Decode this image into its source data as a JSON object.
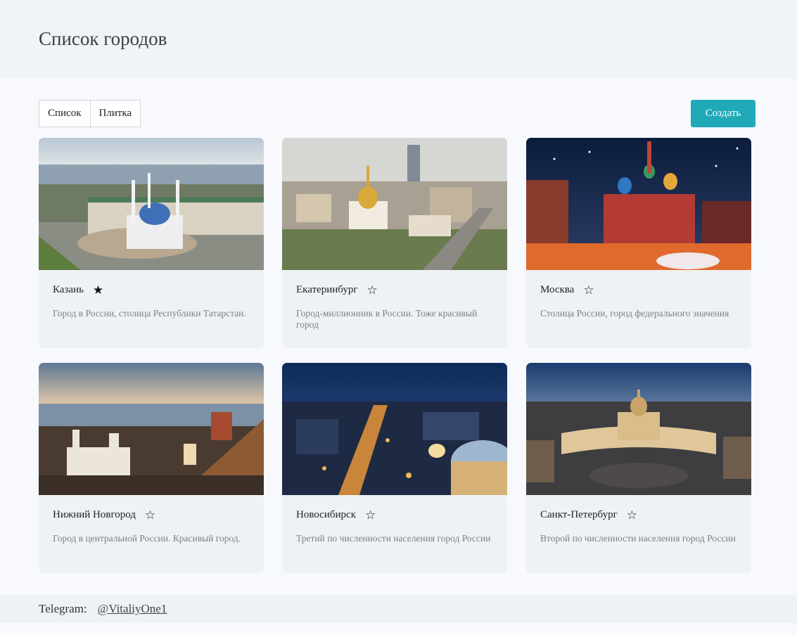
{
  "page": {
    "title": "Список городов"
  },
  "toolbar": {
    "list_label": "Список",
    "tile_label": "Плитка",
    "create_label": "Создать"
  },
  "cities": [
    {
      "name": "Казань",
      "favorite": true,
      "description": "Город в России, столица Республики Татарстан."
    },
    {
      "name": "Екатеринбург",
      "favorite": false,
      "description": "Город-миллионник в России. Тоже красивый город"
    },
    {
      "name": "Москва",
      "favorite": false,
      "description": "Столица России, город федерального значения"
    },
    {
      "name": "Нижний Новгород",
      "favorite": false,
      "description": "Город в центральной России. Красивый город."
    },
    {
      "name": "Новосибирск",
      "favorite": false,
      "description": "Третий по численности населения город России"
    },
    {
      "name": "Санкт-Петербург",
      "favorite": false,
      "description": "Второй по численности населения город России"
    }
  ],
  "icons": {
    "favorite_on": "★",
    "favorite_off": "☆"
  },
  "footer": {
    "label": "Telegram:",
    "link_text": "@VitaliyOne1"
  },
  "colors": {
    "accent": "#20a9b9",
    "card_bg": "#eff2f5"
  }
}
